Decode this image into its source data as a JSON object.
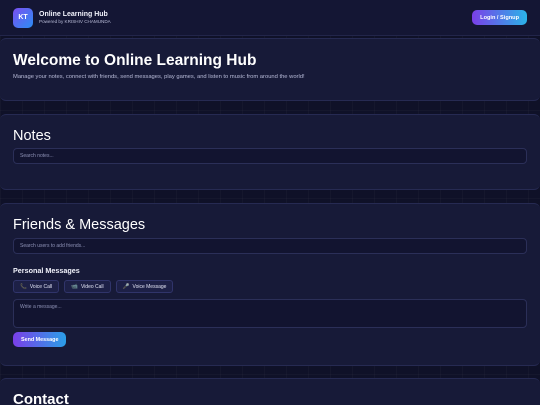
{
  "header": {
    "logo_text": "KT",
    "title": "Online Learning Hub",
    "subtitle": "Powered by KRISHIV CHAMUNDA",
    "login_label": "Login / Signup"
  },
  "welcome": {
    "title": "Welcome to Online Learning Hub",
    "description": "Manage your notes, connect with friends, send messages, play games, and listen to music from around the world!"
  },
  "notes": {
    "title": "Notes",
    "search_placeholder": "Search notes..."
  },
  "friends": {
    "title": "Friends & Messages",
    "search_placeholder": "Search users to add friends...",
    "personal_title": "Personal Messages",
    "call_buttons": [
      {
        "icon": "phone-icon",
        "glyph": "📞",
        "label": "Voice Call"
      },
      {
        "icon": "video-camera-icon",
        "glyph": "📹",
        "label": "Video Call"
      },
      {
        "icon": "microphone-icon",
        "glyph": "🎤",
        "label": "Voice Message"
      }
    ],
    "message_placeholder": "Write a message...",
    "send_label": "Send Message"
  },
  "contact": {
    "title": "Contact"
  },
  "colors": {
    "background": "#0f1128",
    "card": "#171a38",
    "accent_start": "#7a3fe8",
    "accent_end": "#2bb3e8"
  }
}
